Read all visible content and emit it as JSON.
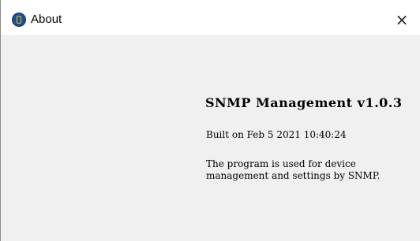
{
  "window": {
    "title": "About",
    "close_glyph": "×",
    "icon": "app-logo-icon"
  },
  "about": {
    "product": "SNMP Management v1.0.3",
    "built": "Built on Feb 5 2021 10:40:24",
    "description_line1": "The program is used for device",
    "description_line2": "management and settings by SNMP."
  }
}
